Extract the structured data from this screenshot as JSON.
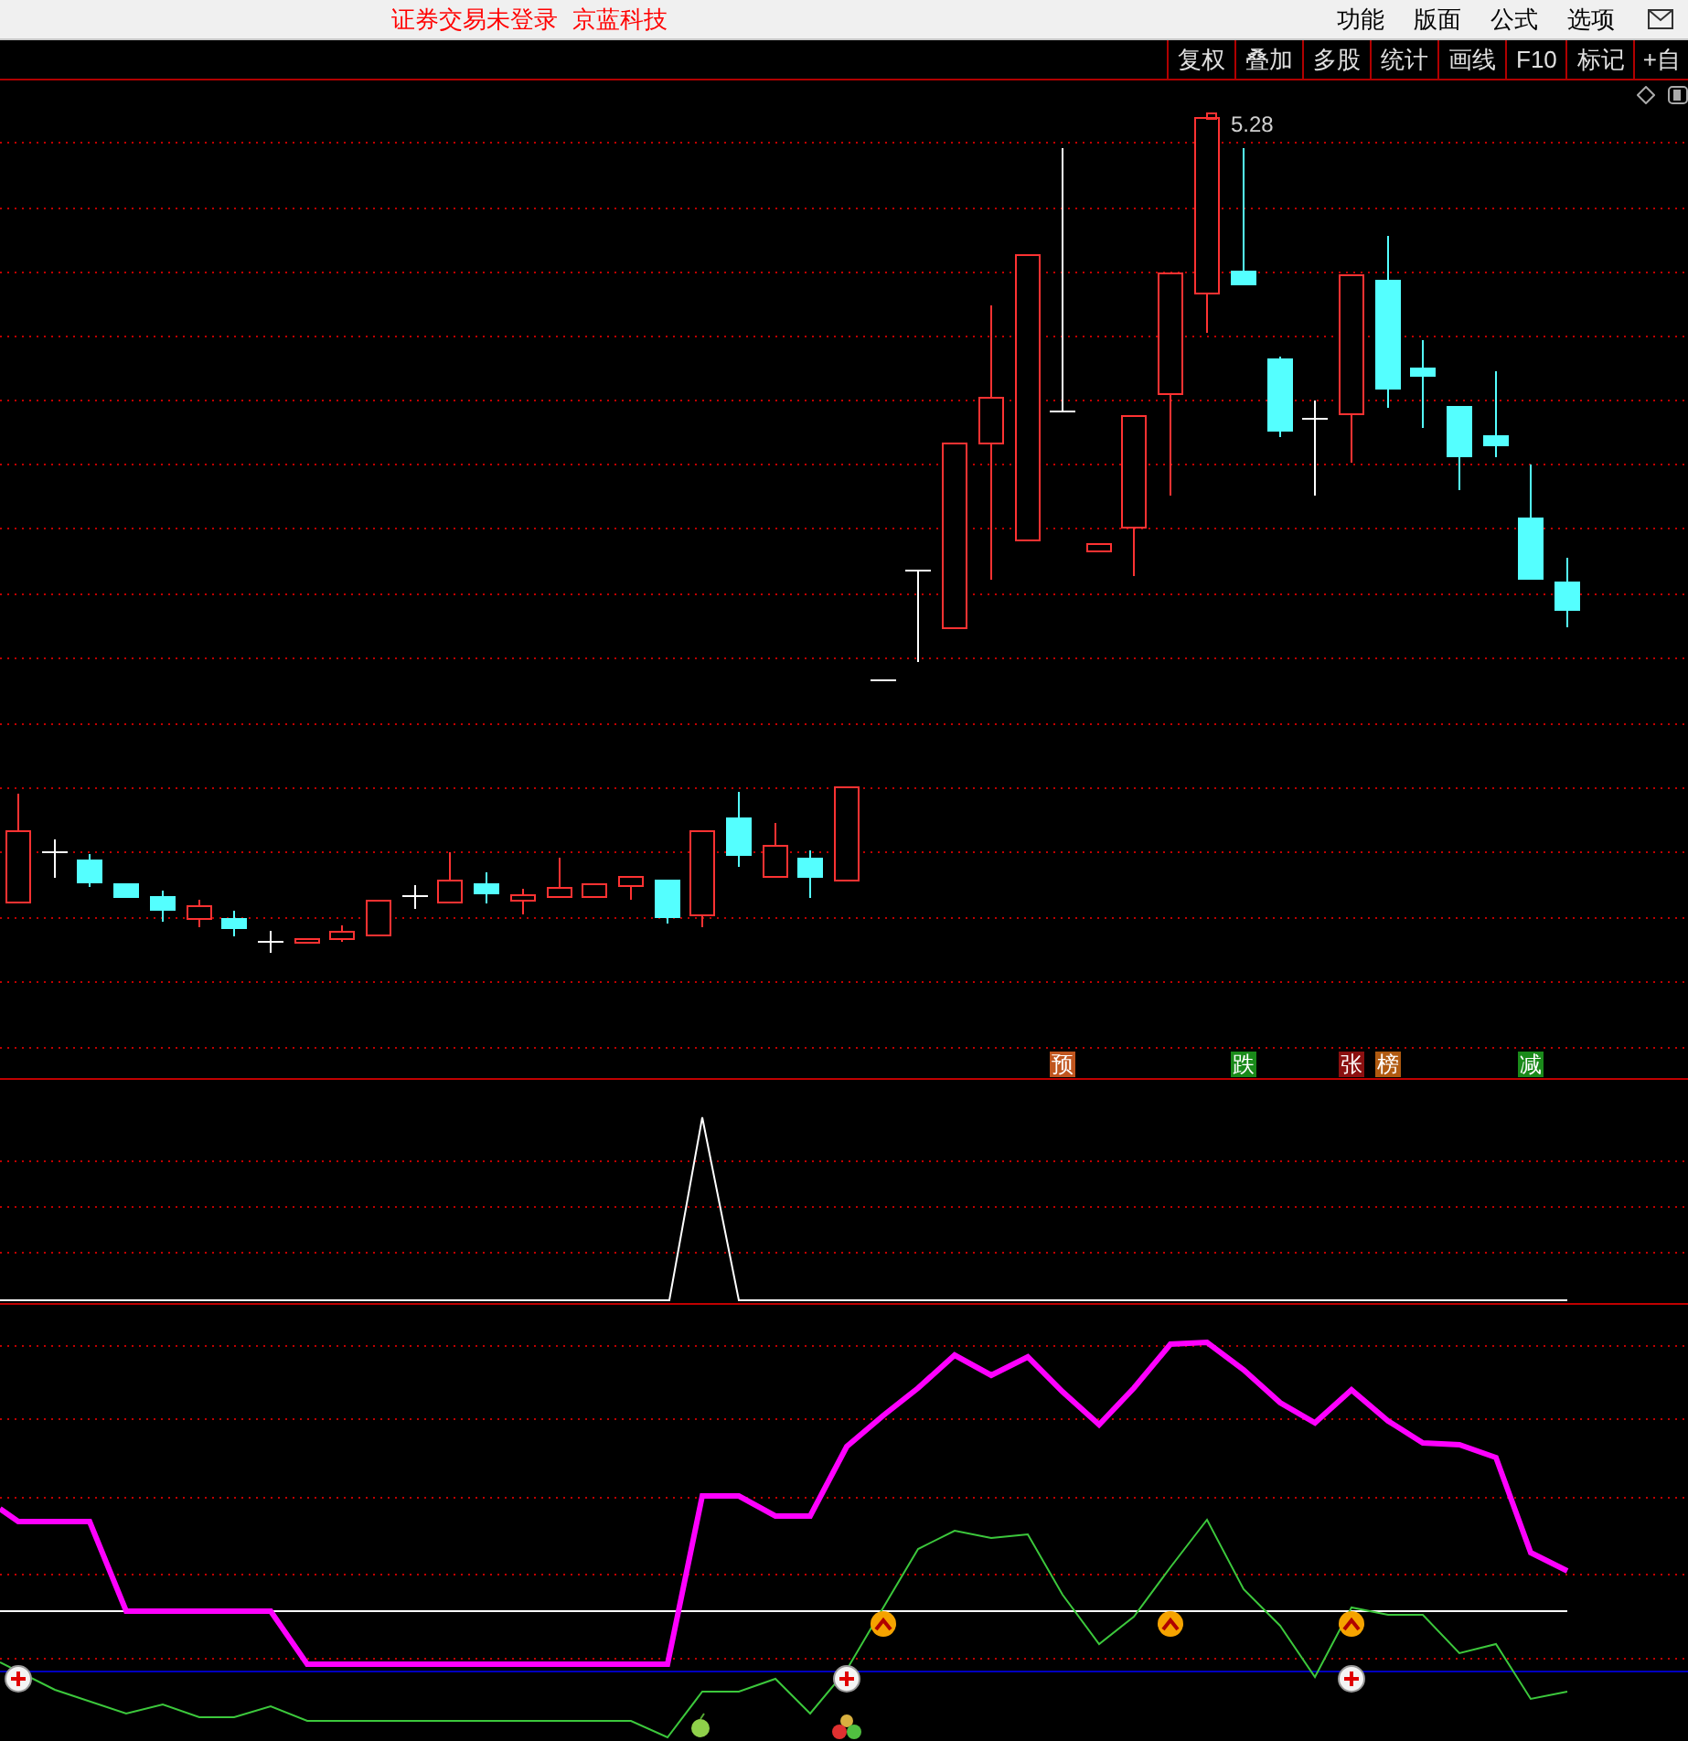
{
  "title_bar": {
    "login_status": "证券交易未登录",
    "stock_name": "京蓝科技",
    "menu": [
      "功能",
      "版面",
      "公式",
      "选项"
    ]
  },
  "toolbar": [
    "复权",
    "叠加",
    "多股",
    "统计",
    "画线",
    "F10",
    "标记",
    "+自"
  ],
  "price_chart": {
    "high_label": "5.28"
  },
  "signals": [
    {
      "text": "预",
      "color": "#c0561f"
    },
    {
      "text": "跌",
      "color": "#1a8a1a"
    },
    {
      "text": "张",
      "color": "#8b1010"
    },
    {
      "text": "榜",
      "color": "#b05a10"
    },
    {
      "text": "减",
      "color": "#1a8a1a"
    }
  ]
}
